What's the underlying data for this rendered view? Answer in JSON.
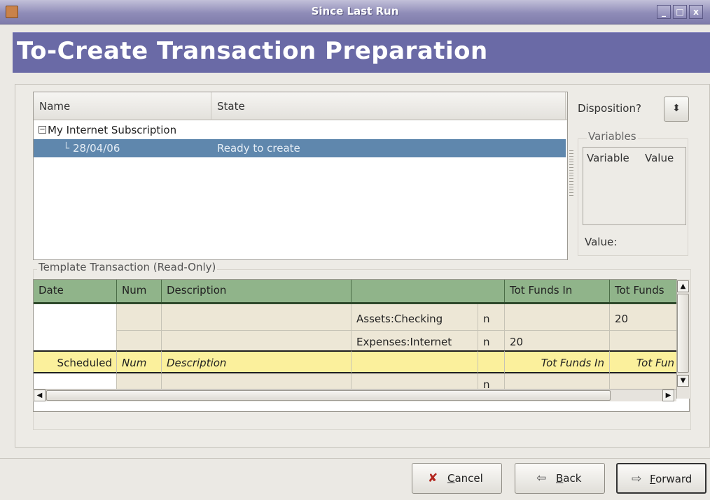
{
  "window": {
    "title": "Since Last Run",
    "minimize": "_",
    "maximize": "□",
    "close": "x"
  },
  "page": {
    "heading": "To-Create Transaction Preparation"
  },
  "tree": {
    "columns": [
      "Name",
      "State"
    ],
    "rows": [
      {
        "name": "My Internet Subscription",
        "state": "",
        "expander": "−"
      },
      {
        "name": "28/04/06",
        "state": "Ready to create",
        "selected": true
      }
    ]
  },
  "disposition": {
    "label": "Disposition?",
    "spinner": "⬍"
  },
  "variables": {
    "group_title": "Variables",
    "columns": [
      "Variable",
      "Value"
    ],
    "value_label": "Value:"
  },
  "template": {
    "group_title": "Template Transaction (Read-Only)",
    "columns": [
      "Date",
      "Num",
      "Description",
      "",
      "",
      "Tot Funds In",
      "Tot Funds"
    ],
    "rows": [
      {
        "date": "",
        "num": "",
        "description": "",
        "account": "",
        "r": "",
        "funds_in": "",
        "funds_out": ""
      },
      {
        "date": "",
        "num": "",
        "description": "",
        "account": "Assets:Checking",
        "r": "n",
        "funds_in": "",
        "funds_out": "20"
      },
      {
        "date": "",
        "num": "",
        "description": "",
        "account": "Expenses:Internet",
        "r": "n",
        "funds_in": "20",
        "funds_out": ""
      },
      {
        "date": "Scheduled",
        "num": "Num",
        "description": "Description",
        "account": "",
        "r": "",
        "funds_in": "Tot Funds In",
        "funds_out": "Tot Fun"
      },
      {
        "date": "",
        "num": "",
        "description": "",
        "account": "",
        "r": "n",
        "funds_in": "",
        "funds_out": ""
      }
    ]
  },
  "buttons": {
    "cancel": {
      "icon": "✘",
      "mnemonic": "C",
      "rest": "ancel"
    },
    "back": {
      "icon": "⇦",
      "mnemonic": "B",
      "rest": "ack"
    },
    "forward": {
      "icon": "⇨",
      "mnemonic": "F",
      "rest": "orward"
    }
  },
  "colors": {
    "header_band": "#6a6aa6",
    "selection": "#5f87ad",
    "register_header": "#90b48a",
    "scheduled_row": "#fbf09c"
  }
}
